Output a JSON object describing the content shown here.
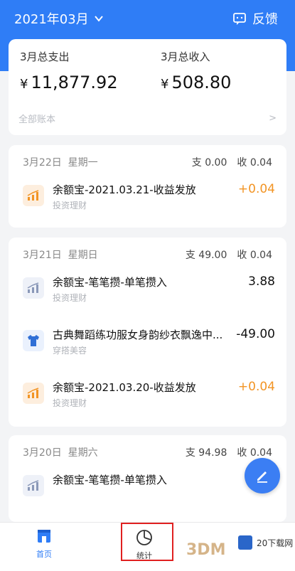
{
  "header": {
    "month": "2021年03月",
    "feedback_label": "反馈",
    "accent": "#2f7df6"
  },
  "summary": {
    "expense_label": "3月总支出",
    "expense_value": "11,877.92",
    "income_label": "3月总收入",
    "income_value": "508.80",
    "currency": "¥",
    "all_accounts": "全部账本",
    "chevron": ">"
  },
  "days": [
    {
      "date": "3月22日",
      "weekday": "星期一",
      "expense": "支 0.00",
      "income": "收 0.04",
      "items": [
        {
          "title": "余额宝-2021.03.21-收益发放",
          "category": "投资理财",
          "amount": "+0.04",
          "icon": "bar-growth-icon"
        }
      ]
    },
    {
      "date": "3月21日",
      "weekday": "星期日",
      "expense": "支 49.00",
      "income": "收 0.04",
      "items": [
        {
          "title": "余额宝-笔笔攒-单笔攒入",
          "category": "投资理财",
          "amount": "3.88",
          "icon": "bar-growth-icon"
        },
        {
          "title": "古典舞蹈练功服女身韵纱衣飘逸中...",
          "category": "穿搭美容",
          "amount": "-49.00",
          "icon": "shirt-icon"
        },
        {
          "title": "余额宝-2021.03.20-收益发放",
          "category": "投资理财",
          "amount": "+0.04",
          "icon": "bar-growth-icon"
        }
      ]
    },
    {
      "date": "3月20日",
      "weekday": "星期六",
      "expense": "支 94.98",
      "income": "收 0.04",
      "items": [
        {
          "title": "余额宝-笔笔攒-单笔攒入",
          "category": "",
          "amount": "",
          "icon": "bar-growth-icon"
        }
      ]
    }
  ],
  "tabs": {
    "home": "首页",
    "stats": "统计"
  },
  "watermark": {
    "logo_text": "3DM",
    "site_text": "20下载网"
  }
}
